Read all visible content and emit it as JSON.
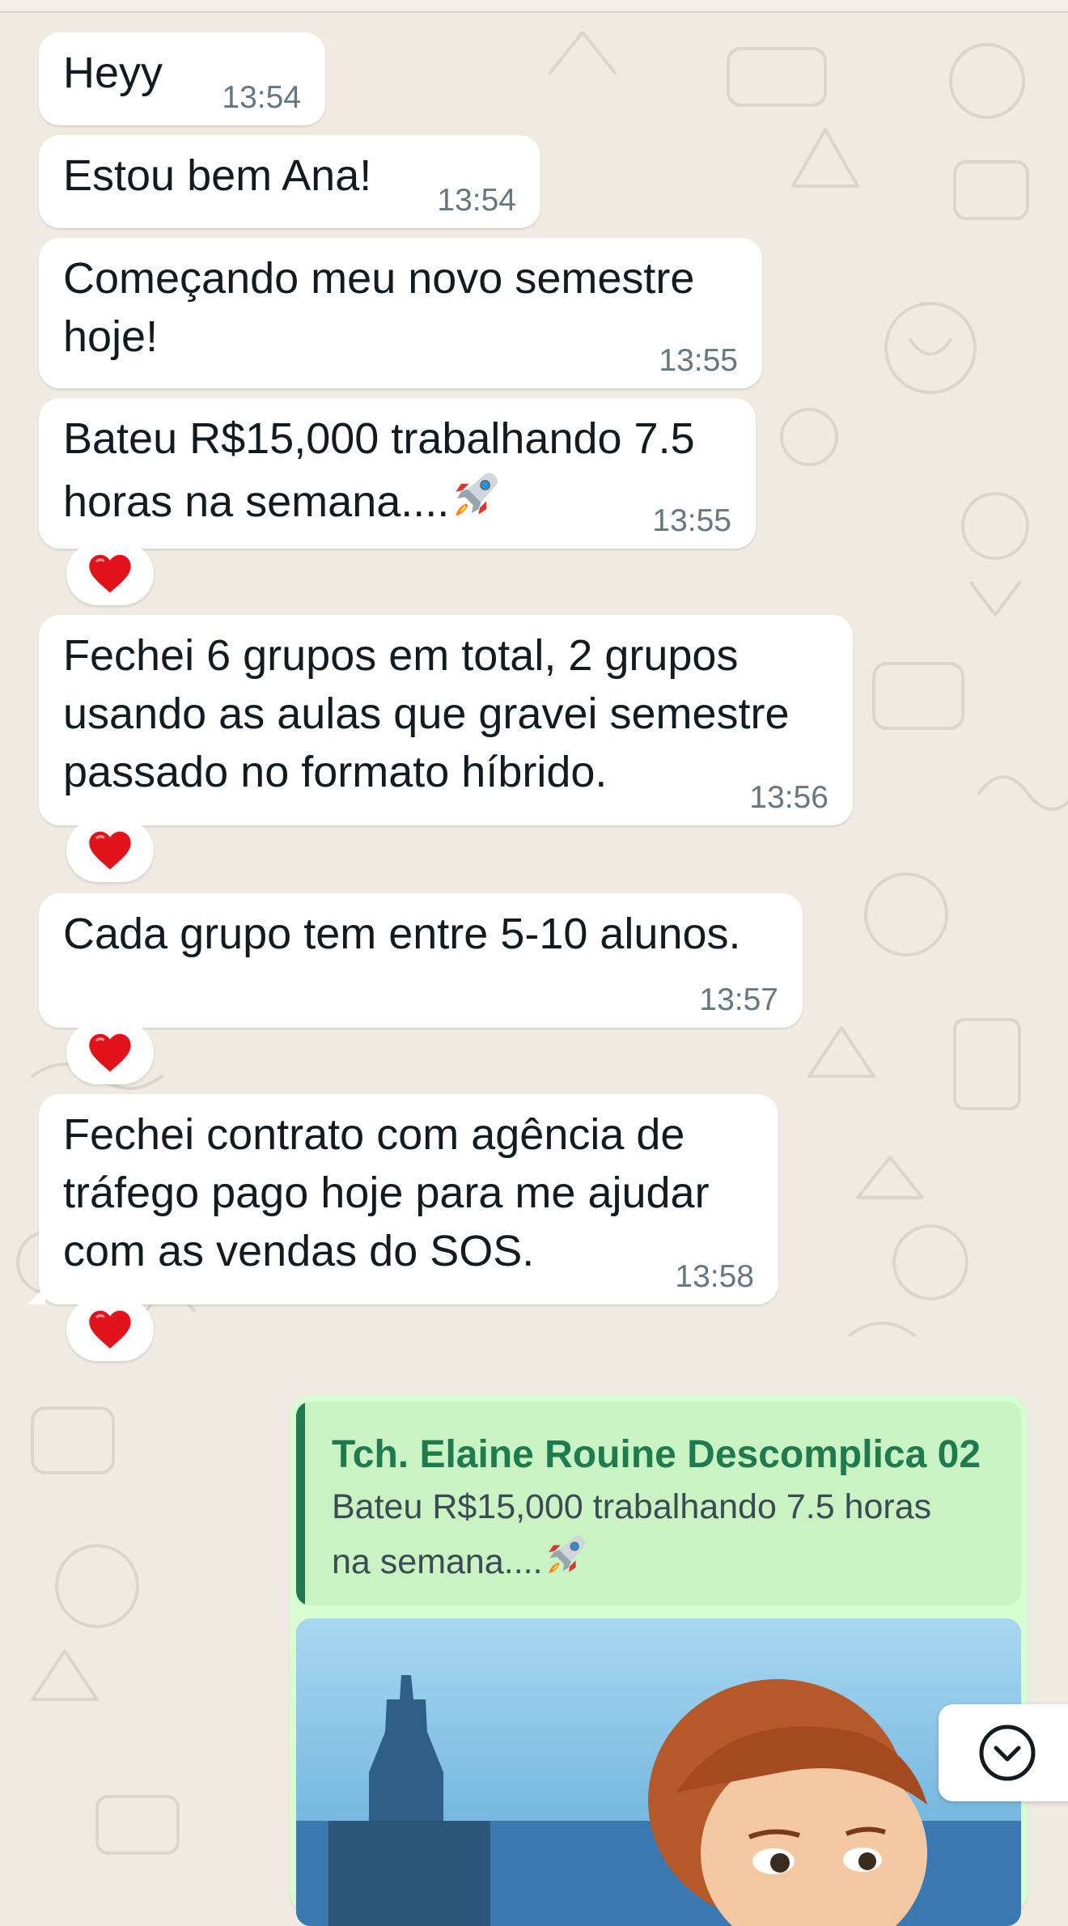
{
  "messages": [
    {
      "text": "Heyy",
      "time": "13:54"
    },
    {
      "text": "Estou bem Ana!",
      "time": "13:54"
    },
    {
      "text": "Começando meu novo semestre\nhoje!",
      "time": "13:55"
    },
    {
      "text": "Bateu R$15,000 trabalhando 7.5\nhoras na semana....",
      "time": "13:55",
      "emoji": "rocket-icon",
      "reaction": "heart-icon"
    },
    {
      "text": "Fechei 6 grupos em total, 2 grupos\nusando as aulas que gravei semestre\npassado no formato híbrido.",
      "time": "13:56",
      "reaction": "heart-icon"
    },
    {
      "text": "Cada grupo tem entre 5-10 alunos.",
      "time": "13:57",
      "reaction": "heart-icon"
    },
    {
      "text": "Fechei contrato com agência de\ntráfego pago hoje para me ajudar\ncom as vendas do SOS.",
      "time": "13:58",
      "reaction": "heart-icon"
    }
  ],
  "outgoing": {
    "quote_author": "Tch. Elaine Rouine Descomplica 02",
    "quote_text": "Bateu R$15,000 trabalhando 7.5 horas\nna semana....",
    "quote_emoji": "rocket-icon"
  },
  "icons": {
    "reaction": "heart-icon",
    "scroll_down": "chevron-down-circle-icon"
  },
  "colors": {
    "chat_background": "#efeae2",
    "incoming_bubble": "#ffffff",
    "outgoing_bubble": "#d9fdd3",
    "quote_accent": "#1f7a4f",
    "timestamp": "#667781",
    "heart": "#e0131b"
  }
}
